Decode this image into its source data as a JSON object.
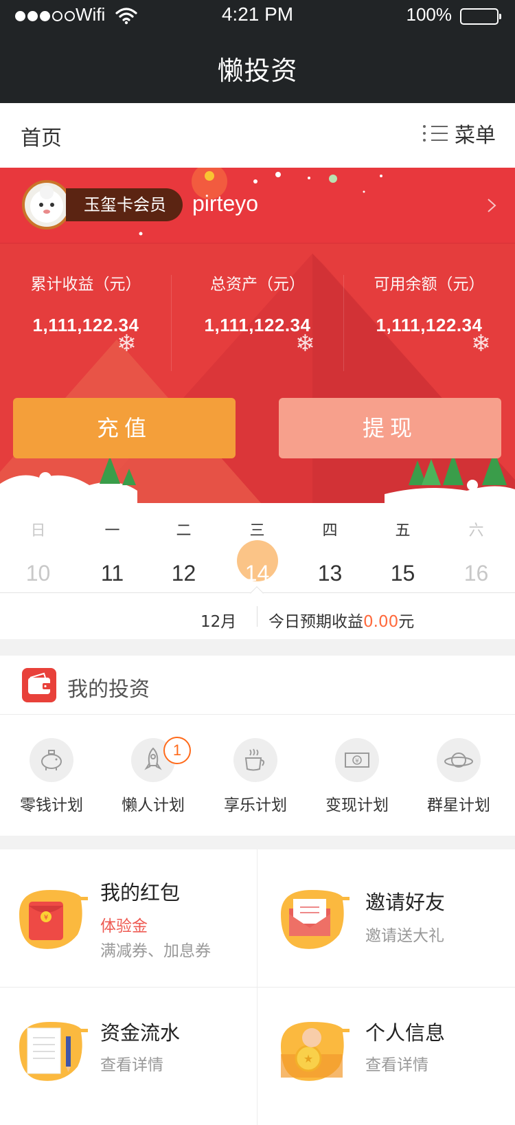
{
  "status_bar": {
    "carrier": "Wifi",
    "time": "4:21 PM",
    "battery": "100%"
  },
  "app": {
    "title": "懒投资"
  },
  "subheader": {
    "home": "首页",
    "menu": "菜单"
  },
  "profile": {
    "member_level": "玉玺卡会员",
    "username": "pirteyo"
  },
  "stats": [
    {
      "label": "累计收益（元）",
      "value": "1,111,122.34"
    },
    {
      "label": "总资产（元）",
      "value": "1,111,122.34"
    },
    {
      "label": "可用余额（元）",
      "value": "1,111,122.34"
    }
  ],
  "actions": {
    "recharge": "充值",
    "withdraw": "提现"
  },
  "calendar": {
    "days": [
      {
        "weekday": "日",
        "date": "10"
      },
      {
        "weekday": "一",
        "date": "11"
      },
      {
        "weekday": "二",
        "date": "12"
      },
      {
        "weekday": "三",
        "date": "14"
      },
      {
        "weekday": "四",
        "date": "13"
      },
      {
        "weekday": "五",
        "date": "15"
      },
      {
        "weekday": "六",
        "date": "16"
      }
    ],
    "selected_index": 3,
    "month": "12月",
    "expected_prefix": "今日预期收益",
    "expected_amount": "0.00",
    "expected_unit": "元"
  },
  "investments": {
    "title": "我的投资",
    "badge": "1",
    "plans": [
      {
        "label": "零钱计划",
        "icon": "piggy-bank-icon"
      },
      {
        "label": "懒人计划",
        "icon": "rocket-icon"
      },
      {
        "label": "享乐计划",
        "icon": "coffee-cup-icon"
      },
      {
        "label": "变现计划",
        "icon": "banknote-icon"
      },
      {
        "label": "群星计划",
        "icon": "planet-icon"
      }
    ]
  },
  "cards": {
    "red_packet": {
      "title": "我的红包",
      "highlight": "体验金",
      "sub": "满减券、加息券"
    },
    "invite": {
      "title": "邀请好友",
      "sub": "邀请送大礼"
    },
    "funds": {
      "title": "资金流水",
      "sub": "查看详情"
    },
    "profile_info": {
      "title": "个人信息",
      "sub": "查看详情"
    }
  },
  "colors": {
    "nav": "#212426",
    "hero": "#e8383d",
    "recharge": "#f49f3a",
    "withdraw": "#f7a08c",
    "accent": "#ff6a3d",
    "selected_day": "#fbc487"
  }
}
